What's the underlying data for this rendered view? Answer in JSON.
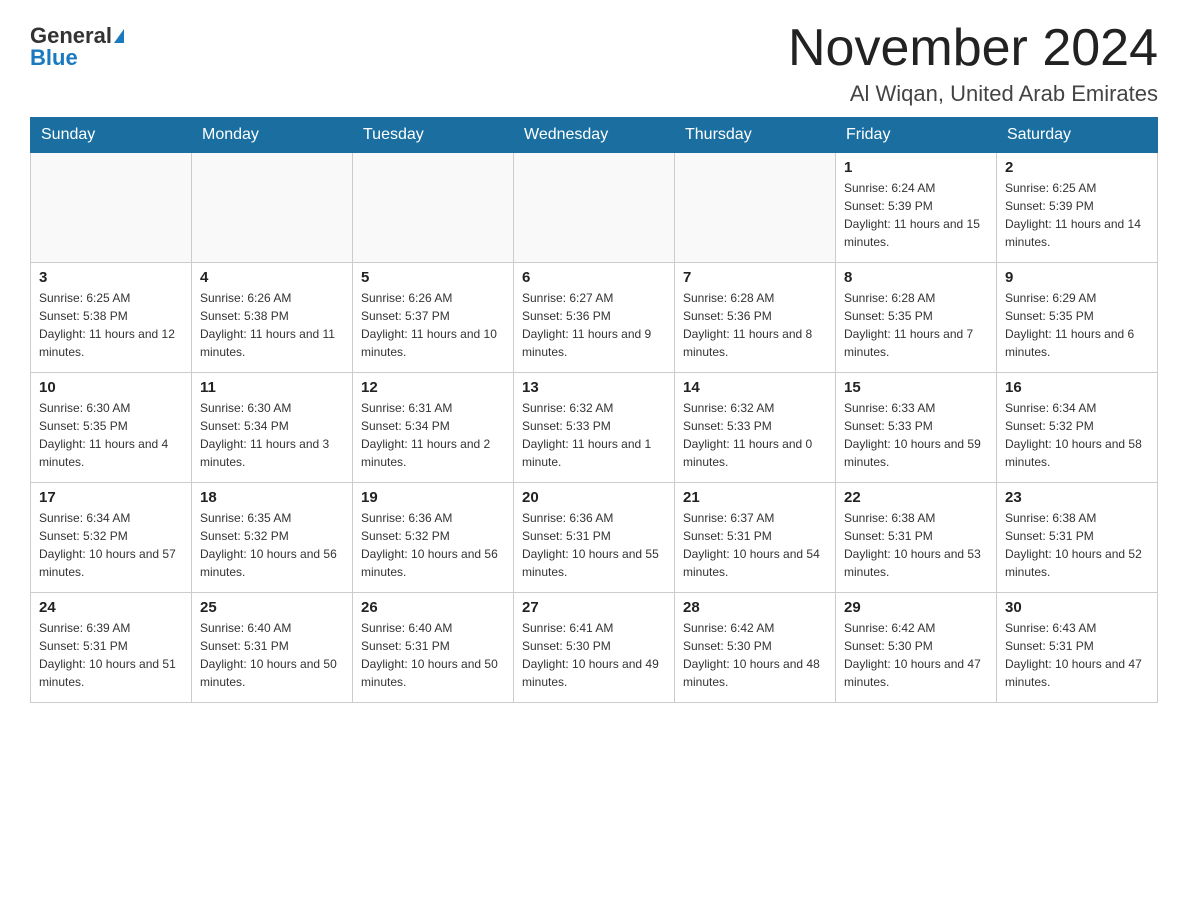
{
  "header": {
    "logo_general": "General",
    "logo_blue": "Blue",
    "month_title": "November 2024",
    "location": "Al Wiqan, United Arab Emirates"
  },
  "days_of_week": [
    "Sunday",
    "Monday",
    "Tuesday",
    "Wednesday",
    "Thursday",
    "Friday",
    "Saturday"
  ],
  "weeks": [
    [
      {
        "day": "",
        "info": ""
      },
      {
        "day": "",
        "info": ""
      },
      {
        "day": "",
        "info": ""
      },
      {
        "day": "",
        "info": ""
      },
      {
        "day": "",
        "info": ""
      },
      {
        "day": "1",
        "info": "Sunrise: 6:24 AM\nSunset: 5:39 PM\nDaylight: 11 hours and 15 minutes."
      },
      {
        "day": "2",
        "info": "Sunrise: 6:25 AM\nSunset: 5:39 PM\nDaylight: 11 hours and 14 minutes."
      }
    ],
    [
      {
        "day": "3",
        "info": "Sunrise: 6:25 AM\nSunset: 5:38 PM\nDaylight: 11 hours and 12 minutes."
      },
      {
        "day": "4",
        "info": "Sunrise: 6:26 AM\nSunset: 5:38 PM\nDaylight: 11 hours and 11 minutes."
      },
      {
        "day": "5",
        "info": "Sunrise: 6:26 AM\nSunset: 5:37 PM\nDaylight: 11 hours and 10 minutes."
      },
      {
        "day": "6",
        "info": "Sunrise: 6:27 AM\nSunset: 5:36 PM\nDaylight: 11 hours and 9 minutes."
      },
      {
        "day": "7",
        "info": "Sunrise: 6:28 AM\nSunset: 5:36 PM\nDaylight: 11 hours and 8 minutes."
      },
      {
        "day": "8",
        "info": "Sunrise: 6:28 AM\nSunset: 5:35 PM\nDaylight: 11 hours and 7 minutes."
      },
      {
        "day": "9",
        "info": "Sunrise: 6:29 AM\nSunset: 5:35 PM\nDaylight: 11 hours and 6 minutes."
      }
    ],
    [
      {
        "day": "10",
        "info": "Sunrise: 6:30 AM\nSunset: 5:35 PM\nDaylight: 11 hours and 4 minutes."
      },
      {
        "day": "11",
        "info": "Sunrise: 6:30 AM\nSunset: 5:34 PM\nDaylight: 11 hours and 3 minutes."
      },
      {
        "day": "12",
        "info": "Sunrise: 6:31 AM\nSunset: 5:34 PM\nDaylight: 11 hours and 2 minutes."
      },
      {
        "day": "13",
        "info": "Sunrise: 6:32 AM\nSunset: 5:33 PM\nDaylight: 11 hours and 1 minute."
      },
      {
        "day": "14",
        "info": "Sunrise: 6:32 AM\nSunset: 5:33 PM\nDaylight: 11 hours and 0 minutes."
      },
      {
        "day": "15",
        "info": "Sunrise: 6:33 AM\nSunset: 5:33 PM\nDaylight: 10 hours and 59 minutes."
      },
      {
        "day": "16",
        "info": "Sunrise: 6:34 AM\nSunset: 5:32 PM\nDaylight: 10 hours and 58 minutes."
      }
    ],
    [
      {
        "day": "17",
        "info": "Sunrise: 6:34 AM\nSunset: 5:32 PM\nDaylight: 10 hours and 57 minutes."
      },
      {
        "day": "18",
        "info": "Sunrise: 6:35 AM\nSunset: 5:32 PM\nDaylight: 10 hours and 56 minutes."
      },
      {
        "day": "19",
        "info": "Sunrise: 6:36 AM\nSunset: 5:32 PM\nDaylight: 10 hours and 56 minutes."
      },
      {
        "day": "20",
        "info": "Sunrise: 6:36 AM\nSunset: 5:31 PM\nDaylight: 10 hours and 55 minutes."
      },
      {
        "day": "21",
        "info": "Sunrise: 6:37 AM\nSunset: 5:31 PM\nDaylight: 10 hours and 54 minutes."
      },
      {
        "day": "22",
        "info": "Sunrise: 6:38 AM\nSunset: 5:31 PM\nDaylight: 10 hours and 53 minutes."
      },
      {
        "day": "23",
        "info": "Sunrise: 6:38 AM\nSunset: 5:31 PM\nDaylight: 10 hours and 52 minutes."
      }
    ],
    [
      {
        "day": "24",
        "info": "Sunrise: 6:39 AM\nSunset: 5:31 PM\nDaylight: 10 hours and 51 minutes."
      },
      {
        "day": "25",
        "info": "Sunrise: 6:40 AM\nSunset: 5:31 PM\nDaylight: 10 hours and 50 minutes."
      },
      {
        "day": "26",
        "info": "Sunrise: 6:40 AM\nSunset: 5:31 PM\nDaylight: 10 hours and 50 minutes."
      },
      {
        "day": "27",
        "info": "Sunrise: 6:41 AM\nSunset: 5:30 PM\nDaylight: 10 hours and 49 minutes."
      },
      {
        "day": "28",
        "info": "Sunrise: 6:42 AM\nSunset: 5:30 PM\nDaylight: 10 hours and 48 minutes."
      },
      {
        "day": "29",
        "info": "Sunrise: 6:42 AM\nSunset: 5:30 PM\nDaylight: 10 hours and 47 minutes."
      },
      {
        "day": "30",
        "info": "Sunrise: 6:43 AM\nSunset: 5:31 PM\nDaylight: 10 hours and 47 minutes."
      }
    ]
  ]
}
